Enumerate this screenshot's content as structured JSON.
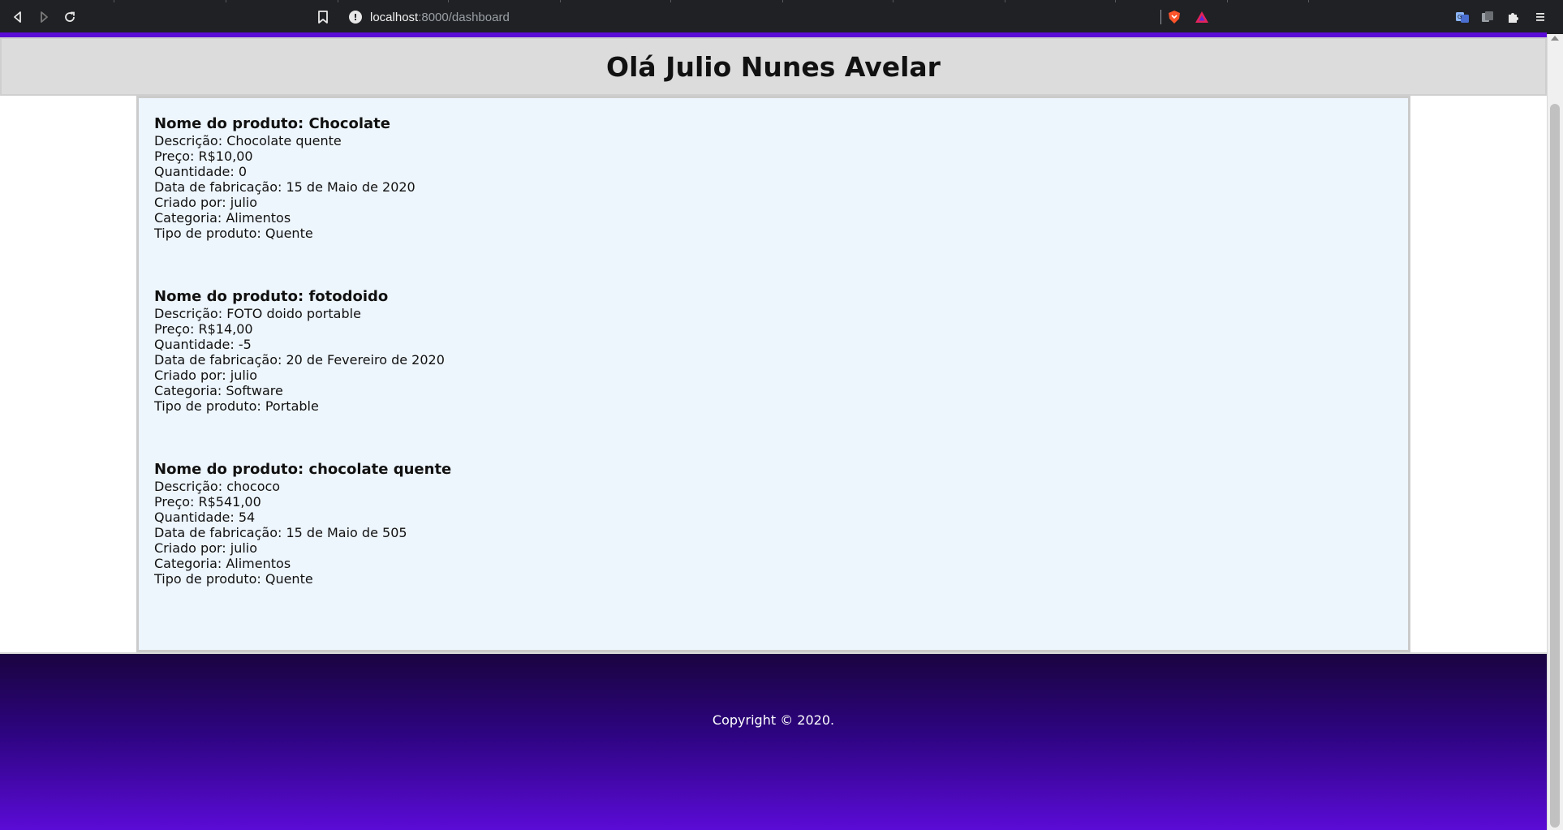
{
  "browser": {
    "url_host": "localhost",
    "url_path": ":8000/dashboard",
    "colors": {
      "chrome": "#202124",
      "accent": "#5b0bd6"
    },
    "icons": [
      "back-icon",
      "forward-icon",
      "reload-icon",
      "bookmark-icon",
      "site-info-icon",
      "brave-shields-icon",
      "brave-rewards-icon",
      "translate-icon",
      "extension-icon",
      "puzzle-extensions-icon",
      "menu-icon"
    ]
  },
  "header": {
    "title": "Olá Julio Nunes Avelar"
  },
  "products": [
    {
      "name": "Nome do produto: Chocolate",
      "description": "Descrição: Chocolate quente",
      "price": "Preço: R$10,00",
      "quantity": "Quantidade: 0",
      "manufacture_date": "Data de fabricação: 15 de Maio de 2020",
      "created_by": "Criado por: julio",
      "category": "Categoria: Alimentos",
      "type": "Tipo de produto: Quente"
    },
    {
      "name": "Nome do produto: fotodoido",
      "description": "Descrição: FOTO doido portable",
      "price": "Preço: R$14,00",
      "quantity": "Quantidade: -5",
      "manufacture_date": "Data de fabricação: 20 de Fevereiro de 2020",
      "created_by": "Criado por: julio",
      "category": "Categoria: Software",
      "type": "Tipo de produto: Portable"
    },
    {
      "name": "Nome do produto: chocolate quente",
      "description": "Descrição: chococo",
      "price": "Preço: R$541,00",
      "quantity": "Quantidade: 54",
      "manufacture_date": "Data de fabricação: 15 de Maio de 505",
      "created_by": "Criado por: julio",
      "category": "Categoria: Alimentos",
      "type": "Tipo de produto: Quente"
    }
  ],
  "footer": {
    "copyright": "Copyright © 2020."
  }
}
